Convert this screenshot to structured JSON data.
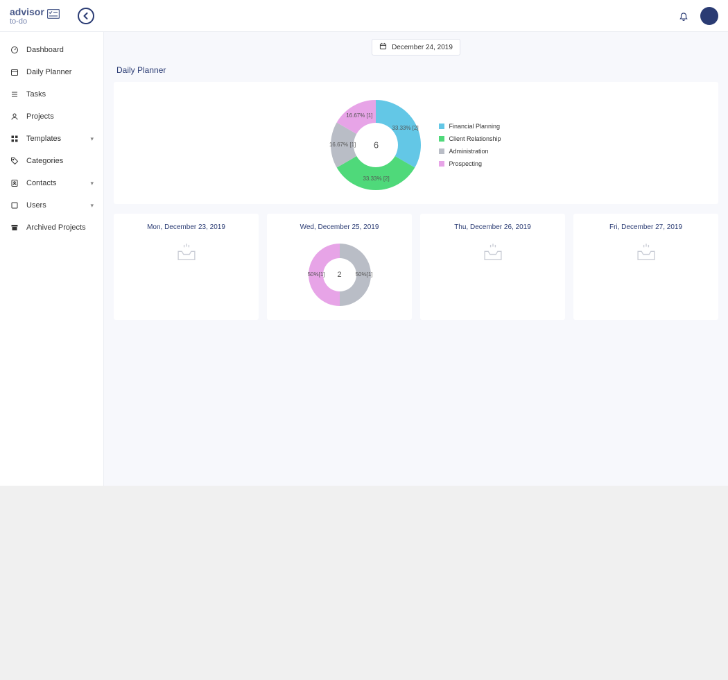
{
  "brand": {
    "main": "advisor",
    "sub": "to-do"
  },
  "header": {
    "date_display": "December 24, 2019"
  },
  "sidebar": {
    "items": [
      {
        "label": "Dashboard",
        "icon": "gauge-icon",
        "expandable": false
      },
      {
        "label": "Daily Planner",
        "icon": "calendar-icon",
        "expandable": false
      },
      {
        "label": "Tasks",
        "icon": "list-icon",
        "expandable": false
      },
      {
        "label": "Projects",
        "icon": "user-icon",
        "expandable": false
      },
      {
        "label": "Templates",
        "icon": "grid-icon",
        "expandable": true
      },
      {
        "label": "Categories",
        "icon": "tag-icon",
        "expandable": false
      },
      {
        "label": "Contacts",
        "icon": "contacts-icon",
        "expandable": true
      },
      {
        "label": "Users",
        "icon": "box-icon",
        "expandable": true
      },
      {
        "label": "Archived Projects",
        "icon": "archive-icon",
        "expandable": false
      }
    ]
  },
  "planner": {
    "title": "Daily Planner",
    "legend": [
      {
        "label": "Financial Planning",
        "color": "#63c7e6"
      },
      {
        "label": "Client Relationship",
        "color": "#4fd97a"
      },
      {
        "label": "Administration",
        "color": "#b9bdc6"
      },
      {
        "label": "Prospecting",
        "color": "#e7a4e7"
      }
    ]
  },
  "chart_data": [
    {
      "type": "pie",
      "title": "Daily Planner — December 24, 2019",
      "total_label": "6",
      "series": [
        {
          "name": "Financial Planning",
          "value": 33.33,
          "count": 2,
          "label": "33.33% [2]",
          "color": "#63c7e6"
        },
        {
          "name": "Client Relationship",
          "value": 33.33,
          "count": 2,
          "label": "33.33% [2]",
          "color": "#4fd97a"
        },
        {
          "name": "Administration",
          "value": 16.67,
          "count": 1,
          "label": "16.67% [1]",
          "color": "#b9bdc6"
        },
        {
          "name": "Prospecting",
          "value": 16.67,
          "count": 1,
          "label": "16.67% [1]",
          "color": "#e7a4e7"
        }
      ]
    },
    {
      "type": "pie",
      "title": "Wed, December 25, 2019",
      "total_label": "2",
      "series": [
        {
          "name": "Administration",
          "value": 50,
          "count": 1,
          "label": "50%[1]",
          "color": "#b9bdc6"
        },
        {
          "name": "Prospecting",
          "value": 50,
          "count": 1,
          "label": "50%[1]",
          "color": "#e7a4e7"
        }
      ]
    }
  ],
  "days": [
    {
      "title": "Mon, December 23, 2019",
      "empty": true,
      "chart_index": null
    },
    {
      "title": "Wed, December 25, 2019",
      "empty": false,
      "chart_index": 1
    },
    {
      "title": "Thu, December 26, 2019",
      "empty": true,
      "chart_index": null
    },
    {
      "title": "Fri, December 27, 2019",
      "empty": true,
      "chart_index": null
    }
  ]
}
